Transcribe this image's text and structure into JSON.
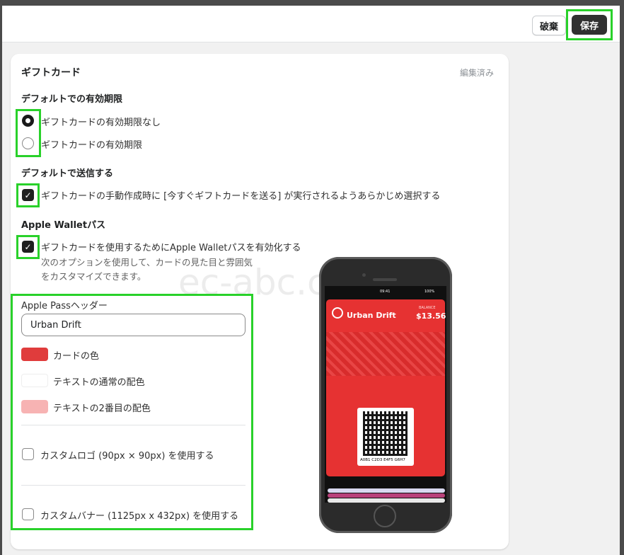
{
  "toolbar": {
    "discard_label": "破棄",
    "save_label": "保存"
  },
  "card": {
    "title": "ギフトカード",
    "status": "編集済み",
    "expiry": {
      "heading": "デフォルトでの有効期限",
      "options": [
        {
          "label": "ギフトカードの有効期限なし",
          "selected": true
        },
        {
          "label": "ギフトカードの有効期限",
          "selected": false
        }
      ]
    },
    "send": {
      "heading": "デフォルトで送信する",
      "checkbox_label": "ギフトカードの手動作成時に [今すぐギフトカードを送る] が実行されるようあらかじめ選択する",
      "checked": true
    },
    "wallet": {
      "heading": "Apple Walletパス",
      "checkbox_label": "ギフトカードを使用するためにApple Walletパスを有効化する",
      "checked": true,
      "help_line1": "次のオプションを使用して、カードの見た目と雰囲気",
      "help_line2": "をカスタマイズできます。"
    },
    "pass": {
      "header_label": "Apple Passヘッダー",
      "header_value": "Urban Drift",
      "colors": [
        {
          "label": "カードの色",
          "hex": "#e03c3c"
        },
        {
          "label": "テキストの通常の配色",
          "hex": "#ffffff"
        },
        {
          "label": "テキストの2番目の配色",
          "hex": "#f7b3b3"
        }
      ],
      "custom_logo_label": "カスタムロゴ (90px × 90px) を使用する",
      "custom_banner_label": "カスタムバナー (1125px x 432px) を使用する"
    }
  },
  "preview": {
    "time": "09:41",
    "battery": "100%",
    "pass_name": "Urban Drift",
    "balance_label": "BALANCE",
    "balance_value": "$13.56",
    "barcode_text": "A0B1 C2D3 E4F5 G6H7"
  },
  "watermark": "ec-abc.com"
}
